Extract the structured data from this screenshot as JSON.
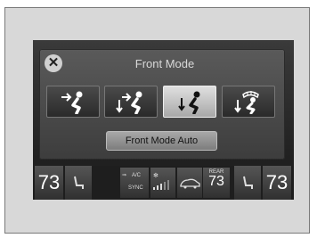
{
  "popup": {
    "title": "Front Mode",
    "close_icon": "close-icon",
    "modes": [
      {
        "icon": "face-vent-icon",
        "selected": false
      },
      {
        "icon": "face-foot-vent-icon",
        "selected": false
      },
      {
        "icon": "foot-vent-icon",
        "selected": true
      },
      {
        "icon": "foot-defrost-icon",
        "selected": false
      }
    ],
    "auto_label": "Front Mode Auto"
  },
  "bottom_bar": {
    "driver_temp": "73",
    "passenger_temp": "73",
    "ac_label": "A/C",
    "sync_label": "SYNC",
    "rear_label": "REAR",
    "rear_temp": "73"
  }
}
